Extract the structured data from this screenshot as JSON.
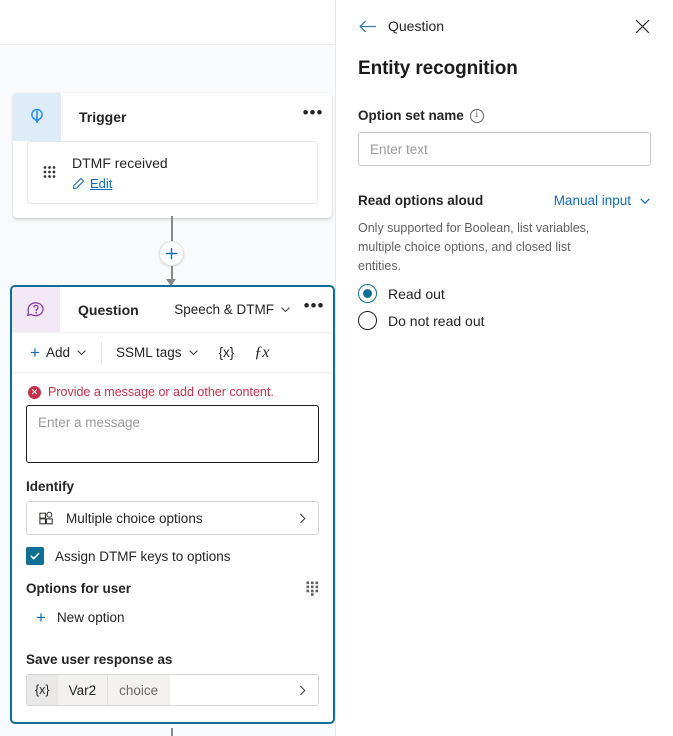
{
  "canvas": {
    "trigger_node": {
      "icon": "trigger-bolt-icon",
      "title": "Trigger",
      "menu": "•••",
      "card": {
        "drag_icon": "drag-waffle-icon",
        "title": "DTMF received",
        "edit_icon": "pencil-icon",
        "edit_label": "Edit"
      }
    },
    "add_node_button": "+",
    "question_node": {
      "icon": "question-bubble-icon",
      "title": "Question",
      "mode": "Speech & DTMF",
      "mode_chevron": "chevron-down-icon",
      "menu": "•••",
      "toolbar": {
        "add_label": "Add",
        "add_plus": "+",
        "add_chevron": "chevron-down-icon",
        "ssml_label": "SSML tags",
        "ssml_chevron": "chevron-down-icon",
        "variable_label": "{x}",
        "formula_label": "ƒx"
      },
      "error": {
        "icon": "error-circle-icon",
        "text": "Provide a message or add other content."
      },
      "message_placeholder": "Enter a message",
      "identify_label": "Identify",
      "identify_value": "Multiple choice options",
      "identify_icon": "multiple-choice-grid-icon",
      "identify_chevron": "chevron-right-icon",
      "assign_dtmf_label": "Assign DTMF keys to options",
      "assign_dtmf_checked": true,
      "options_for_user_label": "Options for user",
      "options_waffle_icon": "waffle-grid-icon",
      "new_option_plus": "+",
      "new_option_label": "New option",
      "save_response_label": "Save user response as",
      "variable": {
        "badge": "{x}",
        "name": "Var2",
        "type": "choice",
        "chevron": "chevron-right-icon"
      }
    }
  },
  "panel": {
    "back_icon": "back-arrow-icon",
    "back_label": "Question",
    "close_icon": "close-icon",
    "title": "Entity recognition",
    "option_set": {
      "label": "Option set name",
      "info_icon": "info-icon",
      "info_glyph": "i",
      "placeholder": "Enter text",
      "value": ""
    },
    "read_options": {
      "title": "Read options aloud",
      "dropdown_value": "Manual input",
      "dropdown_chevron": "chevron-down-icon",
      "helper_text": "Only supported for Boolean, list variables, multiple choice options, and closed list entities.",
      "radios": [
        {
          "label": "Read out",
          "selected": true
        },
        {
          "label": "Do not read out",
          "selected": false
        }
      ]
    }
  },
  "colors": {
    "accent_blue": "#0f6cbd",
    "selection_teal": "#0f6e96",
    "error_red": "#c4314b",
    "trigger_icon_bg": "#deecf9",
    "question_icon_bg": "#f1e7f5",
    "question_icon": "#8a3ca8",
    "canvas_bg": "#f9fafc"
  }
}
